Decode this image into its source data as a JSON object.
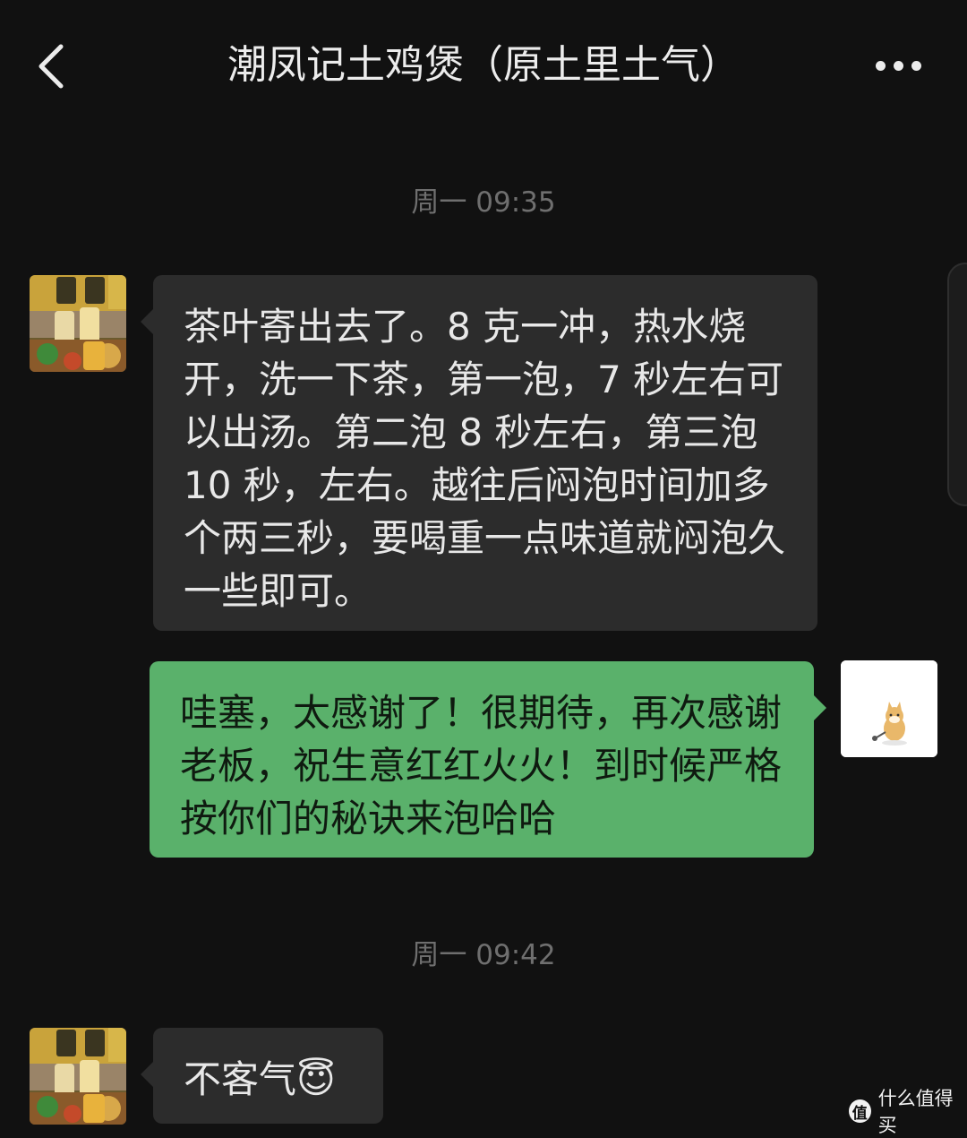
{
  "header": {
    "title": "潮凤记土鸡煲（原土里土气）"
  },
  "messages": [
    {
      "timestamp": "周一 09:35"
    },
    {
      "sender": "contact",
      "text": "茶叶寄出去了。8 克一冲，热水烧开，洗一下茶，第一泡，7 秒左右可以出汤。第二泡 8 秒左右，第三泡 10 秒，左右。越往后闷泡时间加多个两三秒，要喝重一点味道就闷泡久一些即可。"
    },
    {
      "sender": "me",
      "text": "哇塞，太感谢了！很期待，再次感谢老板，祝生意红红火火！到时候严格按你们的秘诀来泡哈哈"
    },
    {
      "timestamp": "周一 09:42"
    },
    {
      "sender": "contact",
      "text": "不客气😇"
    }
  ],
  "watermark": {
    "badge": "值",
    "text": "什么值得买"
  },
  "colors": {
    "background": "#111111",
    "incoming_bubble": "#2c2c2c",
    "outgoing_bubble": "#5ab16b",
    "timestamp": "#6f6f6f"
  },
  "icons": {
    "back": "chevron-left-icon",
    "more": "more-dots-icon"
  }
}
